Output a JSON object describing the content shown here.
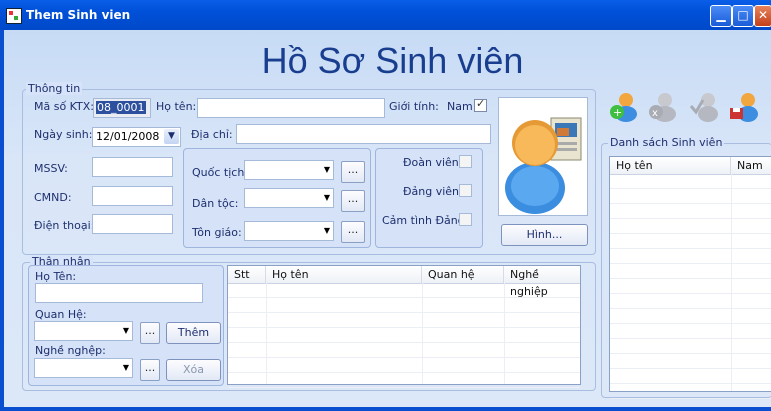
{
  "window": {
    "title": "Them Sinh vien",
    "minimize": "▁",
    "maximize": "□",
    "close": "✕"
  },
  "heading": "Hồ Sơ Sinh viên",
  "thongtin": {
    "group_label": "Thông tin",
    "ktx_label": "Mã số KTX:",
    "ktx_value": "08_0001",
    "hoten_label": "Họ tên:",
    "hoten_value": "",
    "gioitinh_label": "Giới tính:",
    "nam_label": "Nam",
    "nam_checked": true,
    "ngaysinh_label": "Ngày sinh:",
    "ngaysinh_value": "12/01/2008",
    "diachi_label": "Địa chỉ:",
    "mssv_label": "MSSV:",
    "cmnd_label": "CMND:",
    "dienthoai_label": "Điện thoại:",
    "quoctich_label": "Quốc tịch:",
    "dantoc_label": "Dân tộc:",
    "tongiao_label": "Tôn giáo:",
    "dot_button": "...",
    "doanvien_label": "Đoàn viên:",
    "dangvien_label": "Đảng viên:",
    "camtinh_label": "Cảm tình Đảng",
    "photo_button": "Hình..."
  },
  "thannhan": {
    "group_label": "Thân nhân",
    "hoten_label": "Họ Tên:",
    "quanhe_label": "Quan Hệ:",
    "nghenghiep_label": "Nghề nghệp:",
    "dot_button": "...",
    "them_button": "Thêm",
    "xoa_button": "Xóa",
    "columns": [
      "Stt",
      "Họ tên",
      "Quan hệ",
      "Nghề nghiệp"
    ]
  },
  "toolbar": {
    "icons": [
      "add-user-icon",
      "remove-user-icon",
      "approve-user-icon",
      "save-user-icon"
    ]
  },
  "danhsach": {
    "group_label": "Danh sách Sinh viên",
    "columns": [
      "Họ tên",
      "Nam"
    ]
  }
}
